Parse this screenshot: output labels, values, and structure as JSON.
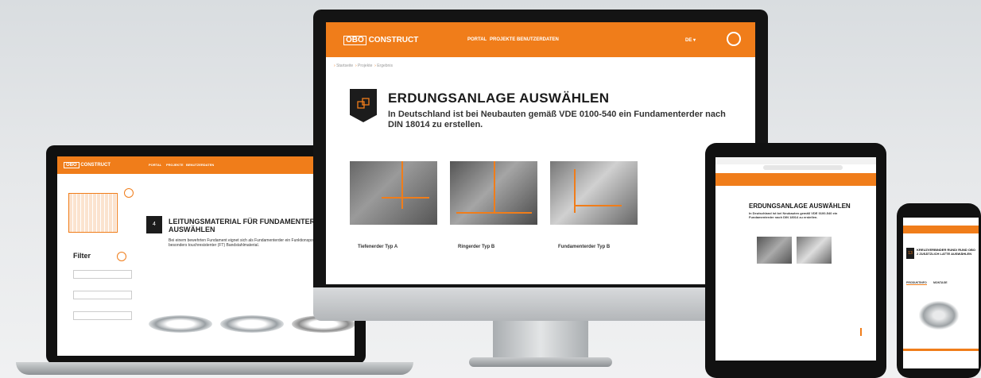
{
  "monitor": {
    "logo_obo": "OBO",
    "logo_construct": "CONSTRUCT",
    "nav": [
      "PORTAL",
      "PROJEKTE",
      "BENUTZERDATEN"
    ],
    "lang": "DE ▾",
    "breadcrumb": [
      "Startseite",
      "Projekte",
      "Ergebnis"
    ],
    "title": "ERDUNGSANLAGE AUSWÄHLEN",
    "subtitle": "In Deutschland ist bei Neubauten gemäß VDE 0100-540 ein Fundamenterder nach DIN 18014 zu erstellen.",
    "options": [
      "Tiefenerder Typ A",
      "Ringerder Typ B",
      "Fundamenterder Typ B"
    ],
    "accent": "#f07d1a"
  },
  "laptop": {
    "logo_obo": "OBO",
    "logo_construct": "CONSTRUCT",
    "nav": [
      "PORTAL",
      "PROJEKTE",
      "BENUTZERDATEN"
    ],
    "step": "4",
    "title": "LEITUNGSMATERIAL FÜR FUNDAMENTERDER AUSWÄHLEN",
    "text": "Bei einem bewehrten Fundament eignet sich als Fundamenterder ein Funktionspotentialausgleichsleiter besonders touchresistenter (FT) Bandstahlmaterial.",
    "filter_title": "Filter"
  },
  "tablet": {
    "title": "ERDUNGSANLAGE AUSWÄHLEN",
    "subtitle": "In Deutschland ist bei Neubauten gemäß VDE 0100-540 ein Fundamenterder nach DIN 18014 zu erstellen."
  },
  "phone": {
    "step": "13",
    "title": "KREUZVERBINDER RUND/ RUND OBO 2 ZUSÄTZLICH LATTE AUSWÄHLEN",
    "tabs": [
      "PRODUKTINFO",
      "MONTAGE"
    ]
  }
}
